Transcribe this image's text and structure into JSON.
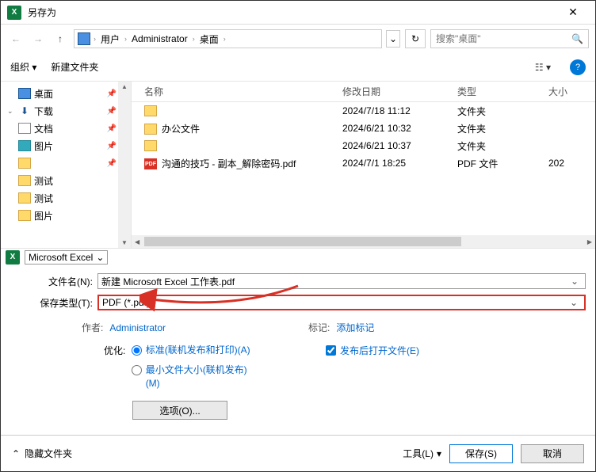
{
  "titlebar": {
    "title": "另存为"
  },
  "breadcrumb": {
    "items": [
      "用户",
      "Administrator",
      "桌面"
    ]
  },
  "search": {
    "placeholder": "搜索\"桌面\""
  },
  "toolbar": {
    "organize": "组织",
    "newfolder": "新建文件夹"
  },
  "sidebar": {
    "items": [
      {
        "label": "桌面",
        "icon": "desktop",
        "pin": true
      },
      {
        "label": "下载",
        "icon": "download",
        "pin": true,
        "exp": true
      },
      {
        "label": "文档",
        "icon": "doc",
        "pin": true
      },
      {
        "label": "图片",
        "icon": "pic",
        "pin": true
      },
      {
        "label": "",
        "icon": "folder",
        "pin": true,
        "redact": true
      },
      {
        "label": "测试",
        "icon": "folder"
      },
      {
        "label": "测试",
        "icon": "folder"
      },
      {
        "label": "图片",
        "icon": "folder"
      }
    ],
    "bottom": {
      "label": "Microsoft Excel"
    }
  },
  "filelist": {
    "headers": {
      "name": "名称",
      "date": "修改日期",
      "type": "类型",
      "size": "大小"
    },
    "rows": [
      {
        "name": "",
        "date": "2024/7/18 11:12",
        "type": "文件夹",
        "icon": "folder",
        "redact": true
      },
      {
        "name": "办公文件",
        "date": "2024/6/21 10:32",
        "type": "文件夹",
        "icon": "folder"
      },
      {
        "name": "",
        "date": "2024/6/21 10:37",
        "type": "文件夹",
        "icon": "folder",
        "redact": true
      },
      {
        "name": "沟通的技巧 - 副本_解除密码.pdf",
        "date": "2024/7/1 18:25",
        "type": "PDF 文件",
        "size": "202",
        "icon": "pdf"
      }
    ]
  },
  "form": {
    "filename_label": "文件名(N):",
    "filename_value": "新建 Microsoft Excel 工作表.pdf",
    "savetype_label": "保存类型(T):",
    "savetype_value": "PDF (*.pdf)"
  },
  "meta": {
    "author_label": "作者:",
    "author_value": "Administrator",
    "tag_label": "标记:",
    "tag_value": "添加标记"
  },
  "opt": {
    "optimize_label": "优化:",
    "radio1": "标准(联机发布和打印)(A)",
    "radio2": "最小文件大小(联机发布)(M)",
    "checkbox": "发布后打开文件(E)",
    "options_btn": "选项(O)..."
  },
  "footer": {
    "hide": "隐藏文件夹",
    "tools": "工具(L)",
    "save": "保存(S)",
    "cancel": "取消"
  }
}
